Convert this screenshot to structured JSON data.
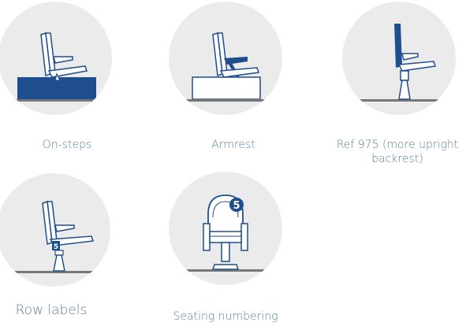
{
  "colors": {
    "circle_bg": "#ebebeb",
    "chair_blue": "#1f4e8f",
    "ground": "#777777",
    "caption": "#5a7f9e"
  },
  "items": [
    {
      "caption": "On-steps",
      "icon": "seat-on-steps-icon"
    },
    {
      "caption": "Armrest",
      "icon": "seat-armrest-icon"
    },
    {
      "caption": "Ref 975 (more upright backrest)",
      "icon": "seat-upright-backrest-icon"
    },
    {
      "caption": "Row labels",
      "icon": "seat-row-label-icon",
      "label_number": "5"
    },
    {
      "caption": "Seating numbering",
      "icon": "seat-numbering-icon",
      "seat_number": "5"
    }
  ]
}
